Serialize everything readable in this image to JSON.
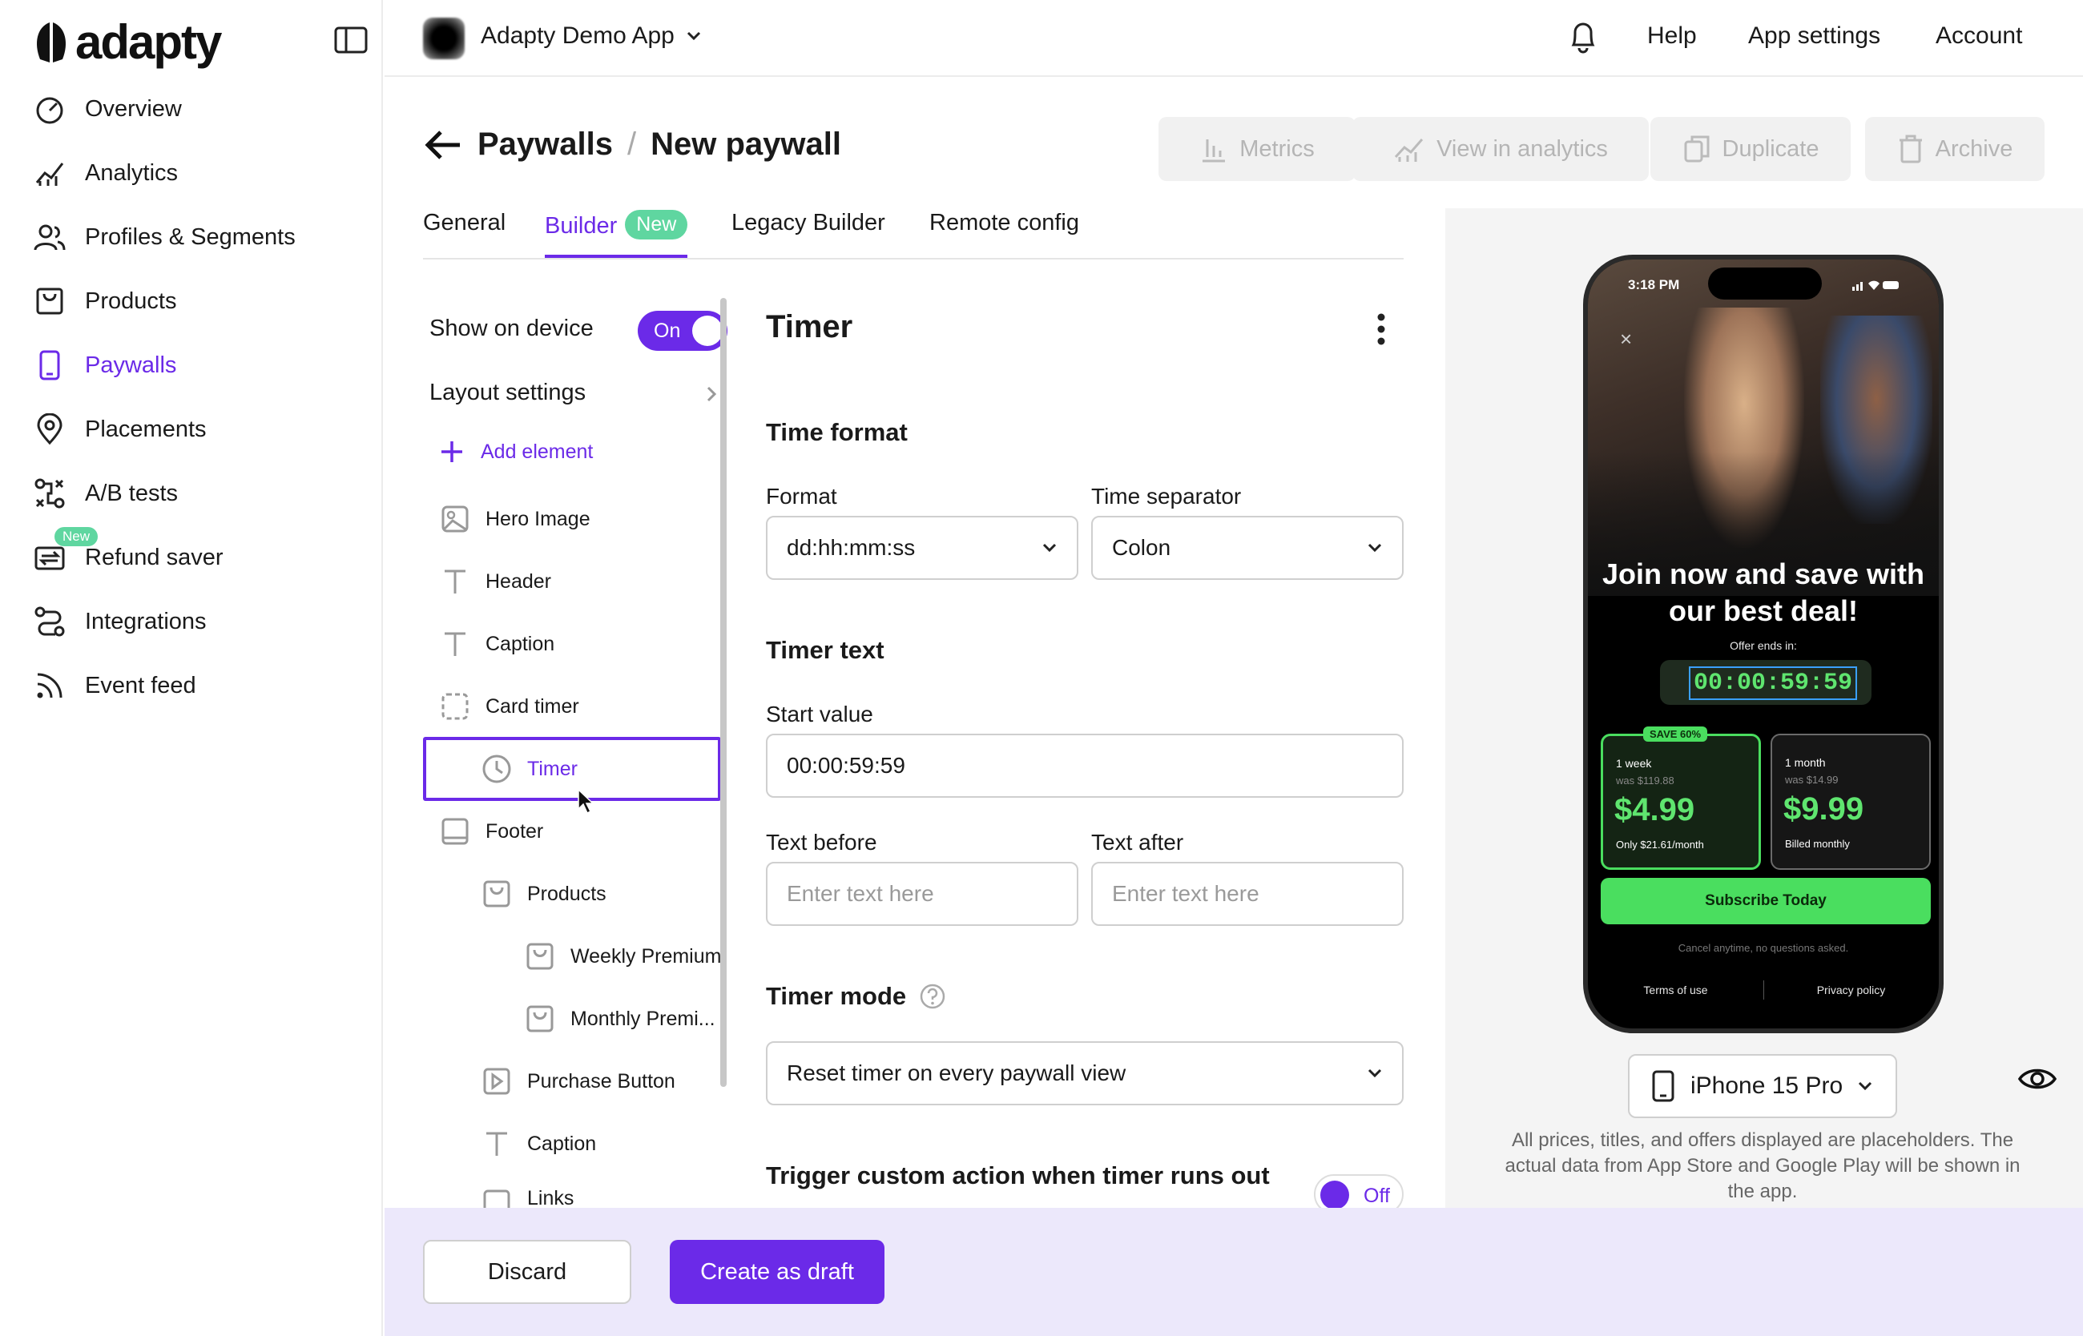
{
  "brand": {
    "logo_text": "adapty",
    "accent": "#6b2ae8",
    "success": "#5fd6a0"
  },
  "sidebar": {
    "items": [
      {
        "label": "Overview",
        "icon": "gauge-icon"
      },
      {
        "label": "Analytics",
        "icon": "chart-icon"
      },
      {
        "label": "Profiles & Segments",
        "icon": "users-icon"
      },
      {
        "label": "Products",
        "icon": "bag-icon"
      },
      {
        "label": "Paywalls",
        "icon": "phone-icon",
        "active": true
      },
      {
        "label": "Placements",
        "icon": "pin-icon"
      },
      {
        "label": "A/B tests",
        "icon": "split-icon"
      },
      {
        "label": "Refund saver",
        "icon": "refund-icon",
        "badge": "New"
      },
      {
        "label": "Integrations",
        "icon": "route-icon"
      },
      {
        "label": "Event feed",
        "icon": "rss-icon"
      }
    ]
  },
  "header": {
    "app_name": "Adapty Demo App",
    "help": "Help",
    "app_settings": "App settings",
    "account": "Account"
  },
  "page": {
    "breadcrumb_parent": "Paywalls",
    "breadcrumb_sep": "/",
    "title": "New paywall",
    "actions": [
      "Metrics",
      "View in analytics",
      "Duplicate",
      "Archive"
    ]
  },
  "tabs": [
    {
      "label": "General"
    },
    {
      "label": "Builder",
      "badge": "New",
      "active": true
    },
    {
      "label": "Legacy Builder"
    },
    {
      "label": "Remote config"
    }
  ],
  "tree": {
    "show_on_device": "Show on device",
    "toggle_on": "On",
    "layout_settings": "Layout settings",
    "add_element": "Add element",
    "items": [
      {
        "label": "Hero Image"
      },
      {
        "label": "Header"
      },
      {
        "label": "Caption"
      },
      {
        "label": "Card timer"
      },
      {
        "label": "Timer",
        "selected": true
      },
      {
        "label": "Footer"
      },
      {
        "label": "Products"
      },
      {
        "label": "Weekly Premium"
      },
      {
        "label": "Monthly Premi..."
      },
      {
        "label": "Purchase Button"
      },
      {
        "label": "Caption"
      },
      {
        "label": "Links"
      }
    ]
  },
  "settings": {
    "title": "Timer",
    "time_format_heading": "Time format",
    "format_label": "Format",
    "format_value": "dd:hh:mm:ss",
    "separator_label": "Time separator",
    "separator_value": "Colon",
    "timer_text_heading": "Timer text",
    "start_value_label": "Start value",
    "start_value": "00:00:59:59",
    "text_before_label": "Text before",
    "text_before_placeholder": "Enter text here",
    "text_after_label": "Text after",
    "text_after_placeholder": "Enter text here",
    "timer_mode_heading": "Timer mode",
    "timer_mode_value": "Reset timer on every paywall view",
    "trigger_label": "Trigger custom action when timer runs out",
    "toggle_off": "Off"
  },
  "preview": {
    "status_time": "3:18 PM",
    "headline": "Join now and save with our best deal!",
    "offer_ends": "Offer ends in:",
    "timer": "00:00:59:59",
    "cards": [
      {
        "badge": "SAVE 60%",
        "period": "1 week",
        "was": "was $119.88",
        "price": "$4.99",
        "sub": "Only $21.61/month"
      },
      {
        "period": "1 month",
        "was": "was $14.99",
        "price": "$9.99",
        "sub": "Billed monthly"
      }
    ],
    "cta": "Subscribe Today",
    "cancel_note": "Cancel anytime, no questions asked.",
    "terms": "Terms of use",
    "privacy": "Privacy policy",
    "device": "iPhone 15 Pro",
    "disclaimer": "All prices, titles, and offers displayed are placeholders. The actual data from App Store and Google Play will be shown in the app."
  },
  "footer": {
    "discard": "Discard",
    "create_draft": "Create as draft"
  }
}
